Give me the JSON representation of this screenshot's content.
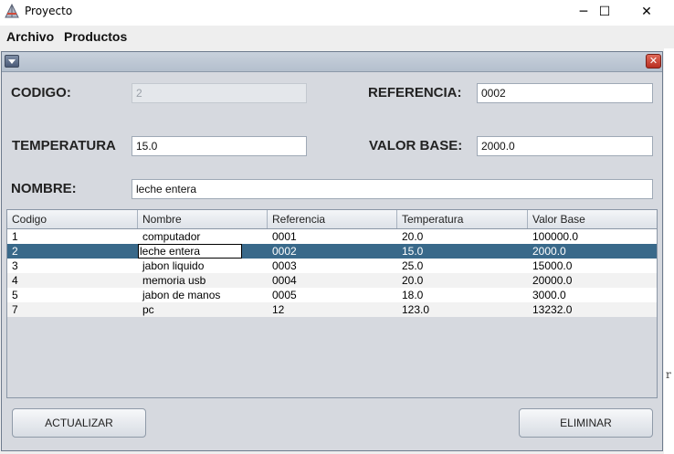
{
  "window": {
    "title": "Proyecto",
    "minimize_glyph": "─",
    "maximize_glyph": "☐",
    "close_glyph": "✕"
  },
  "menubar": {
    "items": [
      {
        "label": "Archivo"
      },
      {
        "label": "Productos"
      }
    ]
  },
  "internal_frame": {
    "close_glyph": "✕"
  },
  "form": {
    "codigo": {
      "label": "CODIGO:",
      "value": "2"
    },
    "referencia": {
      "label": "REFERENCIA:",
      "value": "0002"
    },
    "temperatura": {
      "label": "TEMPERATURA",
      "value": "15.0"
    },
    "valor_base": {
      "label": "VALOR BASE:",
      "value": "2000.0"
    },
    "nombre": {
      "label": "NOMBRE:",
      "value": "leche entera"
    }
  },
  "table": {
    "headers": [
      "Codigo",
      "Nombre",
      "Referencia",
      "Temperatura",
      "Valor Base"
    ],
    "rows": [
      [
        "1",
        "computador",
        "0001",
        "20.0",
        "100000.0"
      ],
      [
        "2",
        "leche entera",
        "0002",
        "15.0",
        "2000.0"
      ],
      [
        "3",
        "jabon liquido",
        "0003",
        "25.0",
        "15000.0"
      ],
      [
        "4",
        "memoria usb",
        "0004",
        "20.0",
        "20000.0"
      ],
      [
        "5",
        "jabon de manos",
        "0005",
        "18.0",
        "3000.0"
      ],
      [
        "7",
        "pc",
        "12",
        "123.0",
        "13232.0"
      ]
    ],
    "selected_row": 1,
    "selection_color": "#39698a"
  },
  "buttons": {
    "actualizar": "ACTUALIZAR",
    "eliminar": "ELIMINAR"
  },
  "edge_char": "r"
}
